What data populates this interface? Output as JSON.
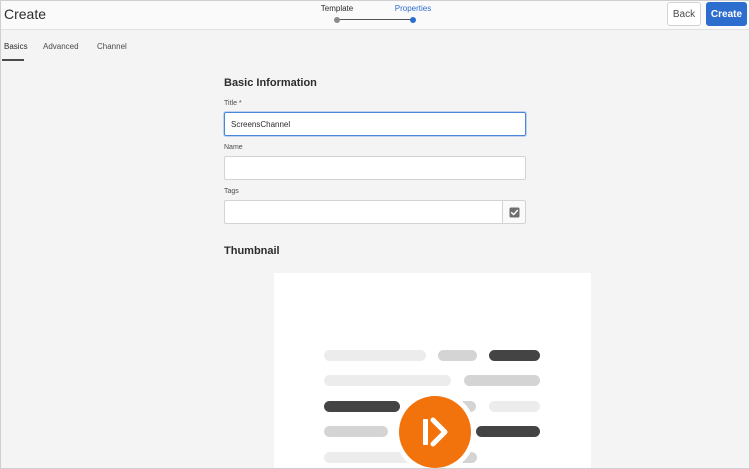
{
  "header": {
    "title": "Create",
    "steps": [
      {
        "label": "Template",
        "state": "completed"
      },
      {
        "label": "Properties",
        "state": "active"
      }
    ],
    "back_label": "Back",
    "create_label": "Create"
  },
  "tabs": [
    {
      "label": "Basics",
      "selected": true
    },
    {
      "label": "Advanced",
      "selected": false
    },
    {
      "label": "Channel",
      "selected": false
    }
  ],
  "form": {
    "basic_heading": "Basic Information",
    "title_label": "Title *",
    "title_value": "ScreensChannel",
    "name_label": "Name",
    "name_value": "",
    "tags_label": "Tags",
    "tags_value": "",
    "thumbnail_heading": "Thumbnail"
  },
  "icons": {
    "tags_picker": "checkbox-icon",
    "thumbnail_logo": "screens-play-icon"
  },
  "colors": {
    "accent": "#2d6dce",
    "logo": "#f2720c"
  }
}
